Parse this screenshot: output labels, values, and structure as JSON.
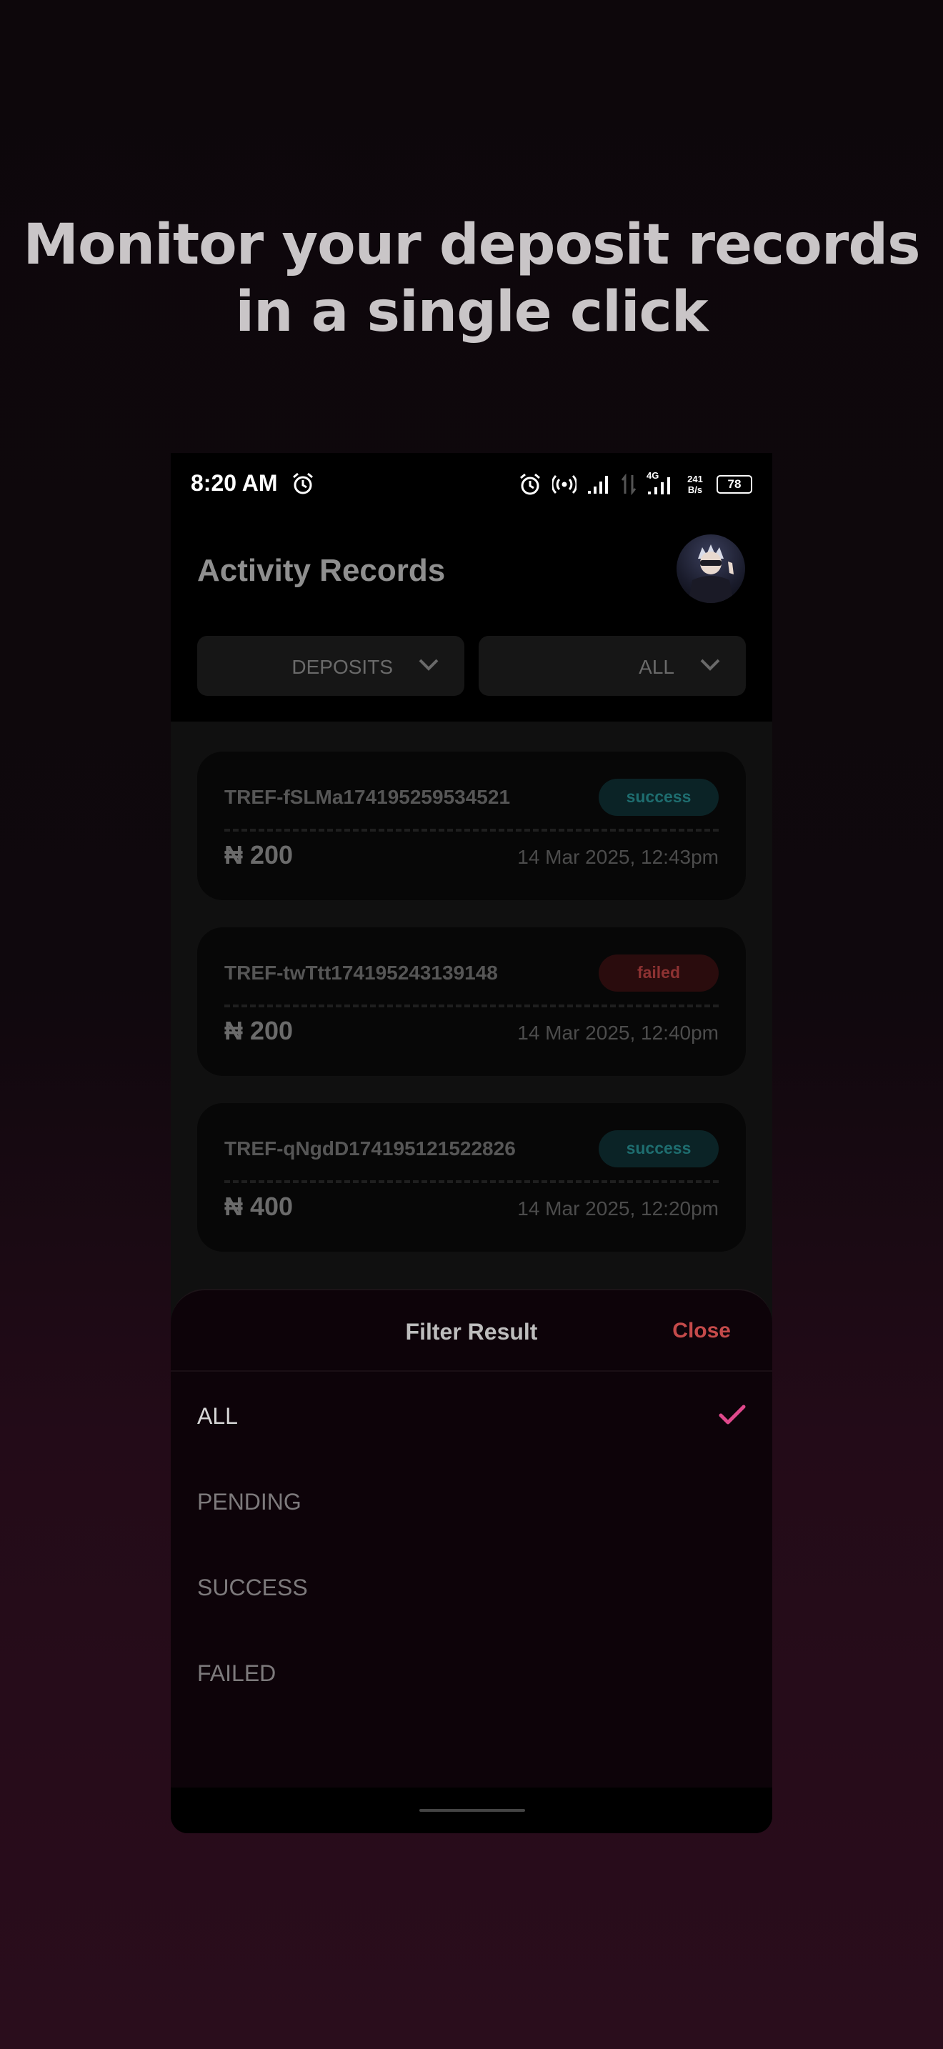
{
  "headline": {
    "line1": "Monitor your deposit records",
    "line2": "in a single click"
  },
  "status_bar": {
    "time": "8:20 AM",
    "network_label": "4G",
    "speed_value": "241",
    "speed_unit": "B/s",
    "battery": "78"
  },
  "header": {
    "title": "Activity Records"
  },
  "filters": {
    "type_label": "DEPOSITS",
    "status_label": "ALL"
  },
  "transactions": [
    {
      "ref": "TREF-fSLMa174195259534521",
      "status": "success",
      "amount": "₦ 200",
      "date": "14 Mar 2025, 12:43pm"
    },
    {
      "ref": "TREF-twTtt174195243139148",
      "status": "failed",
      "amount": "₦ 200",
      "date": "14 Mar 2025, 12:40pm"
    },
    {
      "ref": "TREF-qNgdD174195121522826",
      "status": "success",
      "amount": "₦ 400",
      "date": "14 Mar 2025, 12:20pm"
    }
  ],
  "sheet": {
    "title": "Filter Result",
    "close_label": "Close",
    "options": [
      "ALL",
      "PENDING",
      "SUCCESS",
      "FAILED"
    ],
    "selected": "ALL"
  },
  "colors": {
    "success_text": "#1e6d6f",
    "success_bg": "#0b2326",
    "failed_text": "#8d3232",
    "failed_bg": "#2a0c0d",
    "close": "#c44a4a",
    "check": "#e0488c"
  },
  "icons": [
    "alarm-icon",
    "hotspot-icon",
    "signal-icon",
    "data-arrows-icon",
    "battery-icon",
    "chevron-down-icon",
    "check-icon"
  ]
}
